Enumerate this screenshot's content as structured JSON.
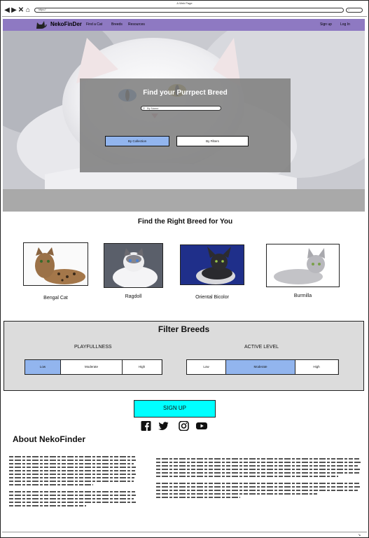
{
  "browser": {
    "window_title": "A Web Page",
    "url": "https://"
  },
  "nav": {
    "brand": "NekoFinDer",
    "links": {
      "find_a_cat": "Find a Cat",
      "breeds": "Breeds",
      "resources": "Resources"
    },
    "right": {
      "sign_up": "Sign up",
      "log_in": "Log In"
    }
  },
  "hero": {
    "heading": "Find your Purrpect Breed",
    "search_placeholder": "By Name",
    "buttons": {
      "by_collection": "By Collection",
      "by_filters": "By Filters"
    }
  },
  "breeds_section": {
    "title": "Find the Right Breed for You",
    "items": [
      {
        "name": "Bengal Cat"
      },
      {
        "name": "Ragdoll"
      },
      {
        "name": "Oriental Bicolor"
      },
      {
        "name": "Burmilla"
      }
    ]
  },
  "filter": {
    "title": "Filter Breeds",
    "playfullness": {
      "label": "PLAYFULLNESS",
      "options": [
        "Low",
        "Moderate",
        "High"
      ],
      "selected": "Low"
    },
    "active_level": {
      "label": "ACTIVE LEVEL",
      "options": [
        "Low",
        "Moderate",
        "High"
      ],
      "selected": "Moderate"
    }
  },
  "signup_button": "SIGN UP",
  "social_icons": [
    "facebook-icon",
    "twitter-icon",
    "instagram-icon",
    "youtube-icon"
  ],
  "about": {
    "title": "About NekoFinder"
  },
  "colors": {
    "nav_bg": "#8e79c2",
    "accent_blue": "#92b5ee",
    "signup_cyan": "#00ffff",
    "filter_bg": "#dcdcdc"
  }
}
